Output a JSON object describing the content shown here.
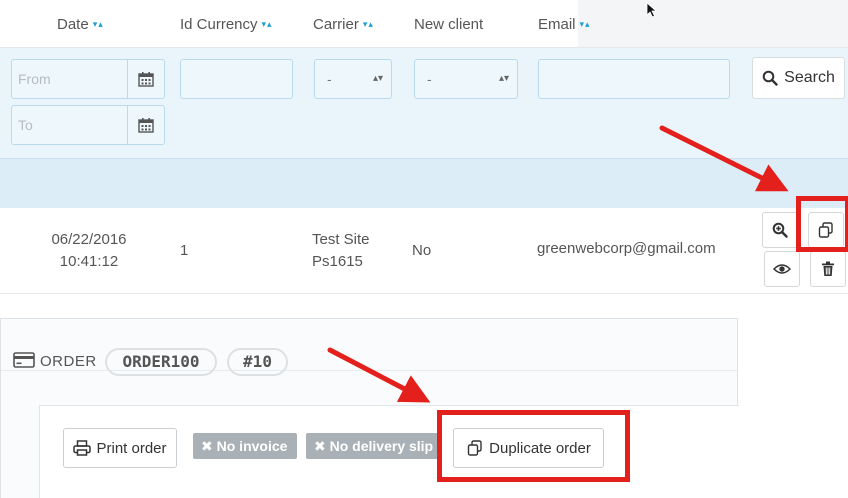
{
  "orders_list": {
    "columns": [
      {
        "label": "Date",
        "sortable": true
      },
      {
        "label": "Id Currency",
        "sortable": true
      },
      {
        "label": "Carrier",
        "sortable": true
      },
      {
        "label": "New client",
        "sortable": false
      },
      {
        "label": "Email",
        "sortable": true
      }
    ],
    "sort_glyph": "▾▴",
    "filters": {
      "date_from_placeholder": "From",
      "date_to_placeholder": "To",
      "carrier_value": "-",
      "new_client_value": "-",
      "select_arrows": "▴▾"
    },
    "search_label": "Search",
    "row": {
      "date": "06/22/2016",
      "time": "10:41:12",
      "id_currency": "1",
      "carrier_line1": "Test Site",
      "carrier_line2": "Ps1615",
      "new_client": "No",
      "email": "greenwebcorp@gmail.com"
    }
  },
  "order_detail": {
    "order_label": "ORDER",
    "reference": "ORDER100",
    "id": "#10",
    "print_label": "Print order",
    "no_invoice_label": "No invoice",
    "no_delivery_label": "No delivery slip",
    "duplicate_label": "Duplicate order",
    "tag_icon": "✖"
  },
  "colors": {
    "annotation_red": "#e3201b",
    "accent_blue": "#1ea0d6",
    "filter_bg": "#eaf5fb"
  }
}
